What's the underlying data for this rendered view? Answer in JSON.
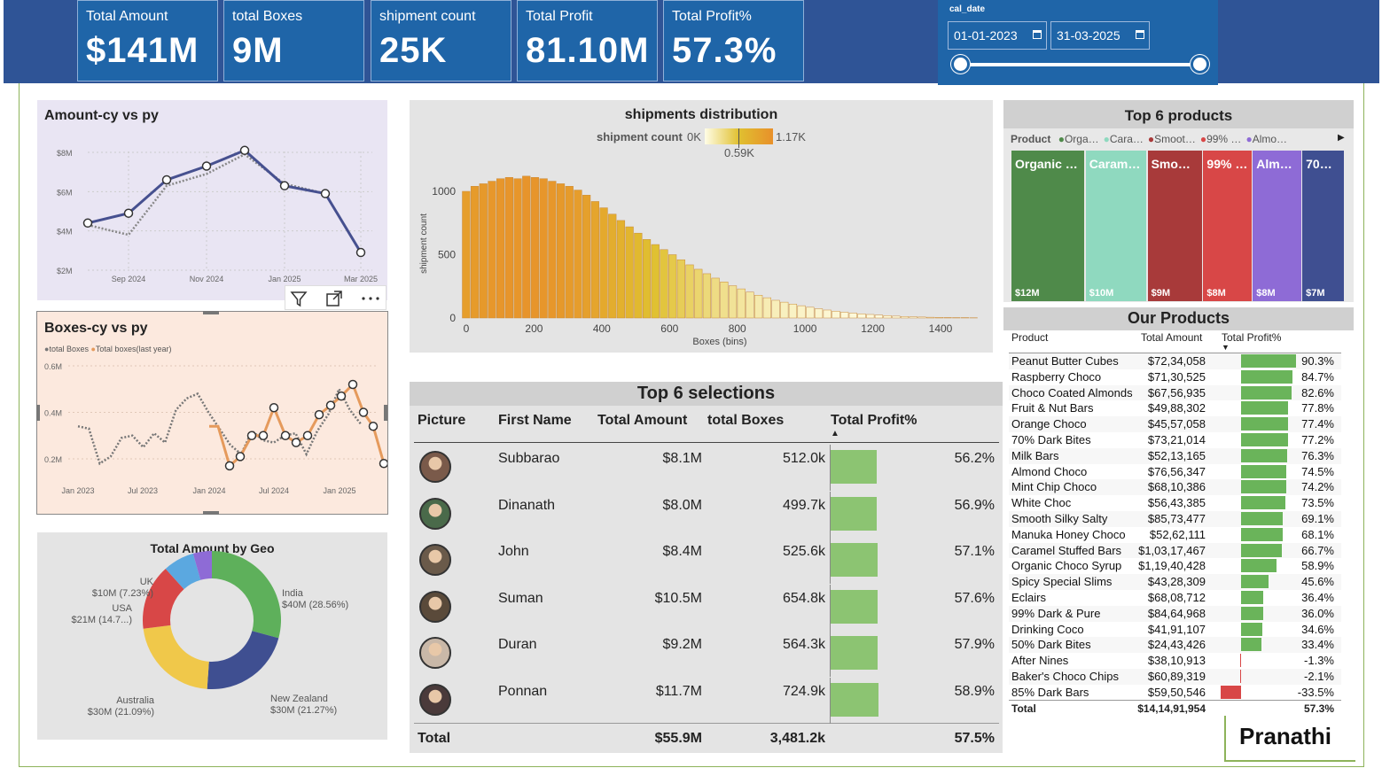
{
  "kpis": [
    {
      "label": "Total Amount",
      "value": "$141M"
    },
    {
      "label": "total Boxes",
      "value": "9M"
    },
    {
      "label": "shipment count",
      "value": "25K"
    },
    {
      "label": "Total Profit",
      "value": "81.10M"
    },
    {
      "label": "Total Profit%",
      "value": "57.3%"
    }
  ],
  "date_filter": {
    "title": "cal_date",
    "start": "01-01-2023",
    "end": "31-03-2025"
  },
  "amount_chart": {
    "title": "Amount-cy vs py",
    "yticks": [
      "$8M",
      "$6M",
      "$4M",
      "$2M"
    ],
    "xticks": [
      "Sep 2024",
      "Nov 2024",
      "Jan 2025",
      "Mar 2025"
    ],
    "chart_data": {
      "type": "line",
      "ylabel": "",
      "ylim": [
        2,
        8.5
      ],
      "series": [
        {
          "values": [
            4.4,
            4.9,
            6.6,
            7.3,
            8.1,
            6.3,
            5.9,
            2.9
          ]
        },
        {
          "values": [
            4.3,
            3.8,
            6.3,
            6.9,
            7.9,
            6.4,
            5.9,
            null
          ]
        }
      ]
    }
  },
  "visual_header": {
    "filter": "filter-icon",
    "expand": "focus-mode-icon",
    "more": "more-options-icon"
  },
  "boxes_chart": {
    "title": "Boxes-cy vs py",
    "legend": [
      "total Boxes",
      "Total boxes(last year)"
    ],
    "yticks": [
      "0.6M",
      "0.4M",
      "0.2M"
    ],
    "xticks": [
      "Jan 2023",
      "Jul 2023",
      "Jan 2024",
      "Jul 2024",
      "Jan 2025"
    ],
    "chart_data": {
      "type": "line",
      "ylim": [
        0.1,
        0.62
      ],
      "series": [
        {
          "name": "total Boxes",
          "values": [
            0.34,
            0.34,
            0.17,
            0.29,
            0.3,
            0.24,
            0.32,
            0.28,
            0.26,
            0.3,
            0.27,
            0.3,
            0.3,
            0.22,
            0.32,
            0.39,
            0.44,
            0.47,
            0.36,
            0.32
          ]
        },
        {
          "name": "Total boxes(last year)",
          "values": [
            null,
            null,
            null,
            null,
            null,
            null,
            null,
            null,
            null,
            null,
            null,
            null,
            0.34,
            0.34,
            0.17,
            0.22,
            0.29,
            0.3,
            0.24,
            0.32,
            0.28,
            0.41,
            0.3,
            0.27,
            0.3,
            0.42,
            0.47,
            0.52,
            0.4,
            0.34,
            0.18
          ]
        }
      ]
    }
  },
  "geo_chart": {
    "title": "Total Amount by Geo",
    "chart_data": {
      "type": "pie",
      "slices": [
        {
          "label": "India",
          "value": 40,
          "pct": "$40M (28.56%)",
          "color": "#5eb05b"
        },
        {
          "label": "New Zealand",
          "value": 30,
          "pct": "$30M (21.27%)",
          "color": "#3f4f91"
        },
        {
          "label": "Australia",
          "value": 30,
          "pct": "$30M (21.09%)",
          "color": "#f0c84a"
        },
        {
          "label": "USA",
          "value": 21,
          "pct": "$21M (14.7...)",
          "color": "#d84747"
        },
        {
          "label": "UK",
          "value": 10,
          "pct": "$10M (7.23%)",
          "color": "#5ba8e0"
        },
        {
          "label": "",
          "value": 6,
          "pct": "",
          "color": "#8e6bd6"
        }
      ]
    }
  },
  "dist_chart": {
    "title": "shipments distribution",
    "legend_title": "shipment count",
    "legend_min": "0K",
    "legend_mid": "0.59K",
    "legend_max": "1.17K",
    "ylabel": "shipment count",
    "xlabel": "Boxes (bins)",
    "yticks": [
      "1000",
      "500",
      "0"
    ],
    "xticks": [
      "0",
      "200",
      "400",
      "600",
      "800",
      "1000",
      "1200",
      "1400"
    ],
    "chart_data": {
      "type": "bar",
      "bin_width": 25,
      "x_start": 0,
      "values": [
        1000,
        1040,
        1060,
        1080,
        1100,
        1110,
        1100,
        1120,
        1110,
        1100,
        1080,
        1060,
        1040,
        1010,
        970,
        920,
        870,
        820,
        770,
        720,
        670,
        620,
        580,
        540,
        500,
        460,
        420,
        385,
        350,
        315,
        285,
        255,
        230,
        205,
        180,
        160,
        140,
        125,
        110,
        97,
        85,
        73,
        63,
        54,
        46,
        39,
        33,
        28,
        23,
        19,
        15,
        12,
        10,
        8,
        6,
        5,
        4,
        3,
        3,
        2
      ]
    }
  },
  "top_products": {
    "title": "Top 6 products",
    "legend_title": "Product",
    "legend": [
      {
        "label": "Orga…",
        "color": "#4f8a4a"
      },
      {
        "label": "Cara…",
        "color": "#8fd9bf"
      },
      {
        "label": "Smoot…",
        "color": "#a83a3a"
      },
      {
        "label": "99% …",
        "color": "#d84747"
      },
      {
        "label": "Almo…",
        "color": "#8e6bd6"
      }
    ],
    "chart_data": {
      "type": "bar",
      "tiles": [
        {
          "name": "Organic …",
          "value": "$12M",
          "amount": 12,
          "color": "#4f8a4a"
        },
        {
          "name": "Caram…",
          "value": "$10M",
          "amount": 10,
          "color": "#8fd9bf"
        },
        {
          "name": "Smo…",
          "value": "$9M",
          "amount": 9,
          "color": "#a83a3a"
        },
        {
          "name": "99% …",
          "value": "$8M",
          "amount": 8,
          "color": "#d84747"
        },
        {
          "name": "Alm…",
          "value": "$8M",
          "amount": 8,
          "color": "#8e6bd6"
        },
        {
          "name": "70…",
          "value": "$7M",
          "amount": 7,
          "color": "#3f4f91"
        }
      ]
    }
  },
  "top_selections": {
    "title": "Top 6 selections",
    "headers": [
      "Picture",
      "First Name",
      "Total Amount",
      "total Boxes",
      "Total Profit%"
    ],
    "rows": [
      {
        "name": "Subbarao",
        "amount": "$8.1M",
        "boxes": "512.0k",
        "profit": "56.2%",
        "p": 56.2
      },
      {
        "name": "Dinanath",
        "amount": "$8.0M",
        "boxes": "499.7k",
        "profit": "56.9%",
        "p": 56.9
      },
      {
        "name": "John",
        "amount": "$8.4M",
        "boxes": "525.6k",
        "profit": "57.1%",
        "p": 57.1
      },
      {
        "name": "Suman",
        "amount": "$10.5M",
        "boxes": "654.8k",
        "profit": "57.6%",
        "p": 57.6
      },
      {
        "name": "Duran",
        "amount": "$9.2M",
        "boxes": "564.3k",
        "profit": "57.9%",
        "p": 57.9
      },
      {
        "name": "Ponnan",
        "amount": "$11.7M",
        "boxes": "724.9k",
        "profit": "58.9%",
        "p": 58.9
      }
    ],
    "total": {
      "label": "Total",
      "amount": "$55.9M",
      "boxes": "3,481.2k",
      "profit": "57.5%"
    }
  },
  "our_products": {
    "title": "Our Products",
    "headers": [
      "Product",
      "Total Amount",
      "Total Profit%"
    ],
    "rows": [
      {
        "name": "Peanut Butter Cubes",
        "amount": "$72,34,058",
        "profit": "90.3%",
        "p": 90.3
      },
      {
        "name": "Raspberry Choco",
        "amount": "$71,30,525",
        "profit": "84.7%",
        "p": 84.7
      },
      {
        "name": "Choco Coated Almonds",
        "amount": "$67,56,935",
        "profit": "82.6%",
        "p": 82.6
      },
      {
        "name": "Fruit & Nut Bars",
        "amount": "$49,88,302",
        "profit": "77.8%",
        "p": 77.8
      },
      {
        "name": "Orange Choco",
        "amount": "$45,57,058",
        "profit": "77.4%",
        "p": 77.4
      },
      {
        "name": "70% Dark Bites",
        "amount": "$73,21,014",
        "profit": "77.2%",
        "p": 77.2
      },
      {
        "name": "Milk Bars",
        "amount": "$52,13,165",
        "profit": "76.3%",
        "p": 76.3
      },
      {
        "name": "Almond Choco",
        "amount": "$76,56,347",
        "profit": "74.5%",
        "p": 74.5
      },
      {
        "name": "Mint Chip Choco",
        "amount": "$68,10,386",
        "profit": "74.2%",
        "p": 74.2
      },
      {
        "name": "White Choc",
        "amount": "$56,43,385",
        "profit": "73.5%",
        "p": 73.5
      },
      {
        "name": "Smooth Silky Salty",
        "amount": "$85,73,477",
        "profit": "69.1%",
        "p": 69.1
      },
      {
        "name": "Manuka Honey Choco",
        "amount": "$52,62,111",
        "profit": "68.1%",
        "p": 68.1
      },
      {
        "name": "Caramel Stuffed Bars",
        "amount": "$1,03,17,467",
        "profit": "66.7%",
        "p": 66.7
      },
      {
        "name": "Organic Choco Syrup",
        "amount": "$1,19,40,428",
        "profit": "58.9%",
        "p": 58.9
      },
      {
        "name": "Spicy Special Slims",
        "amount": "$43,28,309",
        "profit": "45.6%",
        "p": 45.6
      },
      {
        "name": "Eclairs",
        "amount": "$68,08,712",
        "profit": "36.4%",
        "p": 36.4
      },
      {
        "name": "99% Dark & Pure",
        "amount": "$84,64,968",
        "profit": "36.0%",
        "p": 36.0
      },
      {
        "name": "Drinking Coco",
        "amount": "$41,91,107",
        "profit": "34.6%",
        "p": 34.6
      },
      {
        "name": "50% Dark Bites",
        "amount": "$24,43,426",
        "profit": "33.4%",
        "p": 33.4
      },
      {
        "name": "After Nines",
        "amount": "$38,10,913",
        "profit": "-1.3%",
        "p": -1.3
      },
      {
        "name": "Baker's Choco Chips",
        "amount": "$60,89,319",
        "profit": "-2.1%",
        "p": -2.1
      },
      {
        "name": "85% Dark Bars",
        "amount": "$59,50,546",
        "profit": "-33.5%",
        "p": -33.5
      }
    ],
    "total": {
      "label": "Total",
      "amount": "$14,14,91,954",
      "profit": "57.3%"
    }
  },
  "brand": "Pranathi"
}
